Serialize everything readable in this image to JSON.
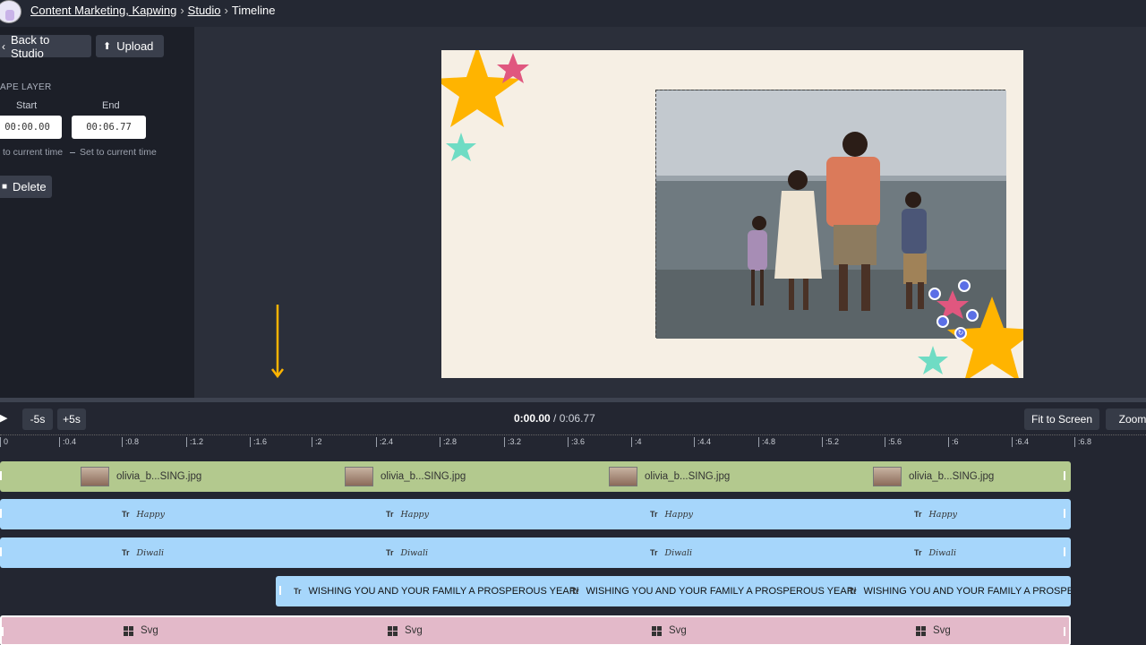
{
  "breadcrumb": {
    "items": [
      "Content Marketing, Kapwing",
      "Studio",
      "Timeline"
    ],
    "separator": "›"
  },
  "left_panel": {
    "back_label": "Back to Studio",
    "upload_label": "Upload",
    "layer_title": "APE LAYER",
    "start_label": "Start",
    "end_label": "End",
    "start_value": "00:00.00",
    "end_value": "00:06.77",
    "set_start_label": "to current time",
    "set_end_label": "Set to current time",
    "delete_label": "Delete"
  },
  "timeline": {
    "minus5": "-5s",
    "plus5": "+5s",
    "current_time": "0:00.00",
    "time_separator": "/",
    "total_time": "0:06.77",
    "fit_label": "Fit to Screen",
    "zoom_label": "Zoom",
    "ruler": [
      "0",
      ":0.4",
      ":0.8",
      ":1.2",
      ":1.6",
      ":2",
      ":2.4",
      ":2.8",
      ":3.2",
      ":3.6",
      ":4",
      ":4.4",
      ":4.8",
      ":5.2",
      ":5.6",
      ":6",
      ":6.4",
      ":6.8"
    ],
    "tracks": {
      "image": {
        "label": "olivia_b...SING.jpg",
        "color": "#b3c98e"
      },
      "text_happy": {
        "label": "Happy",
        "color": "#a6d6fb"
      },
      "text_diwali": {
        "label": "Diwali",
        "color": "#a6d6fb"
      },
      "text_banner": {
        "label": "WISHING YOU AND YOUR FAMILY A PROSPEROUS YEAR!",
        "label_truncated": "WISHING YOU AND YOUR FAMILY A PROSPER",
        "color": "#a6d6fb"
      },
      "shape": {
        "label": "Svg",
        "color": "#e3b9c9"
      }
    },
    "text_icon": "Tr"
  },
  "colors": {
    "accent_star": "#ffb400",
    "pink_star": "#e0577f",
    "teal_star": "#6fdcc4",
    "handle": "#5b6fe6"
  }
}
